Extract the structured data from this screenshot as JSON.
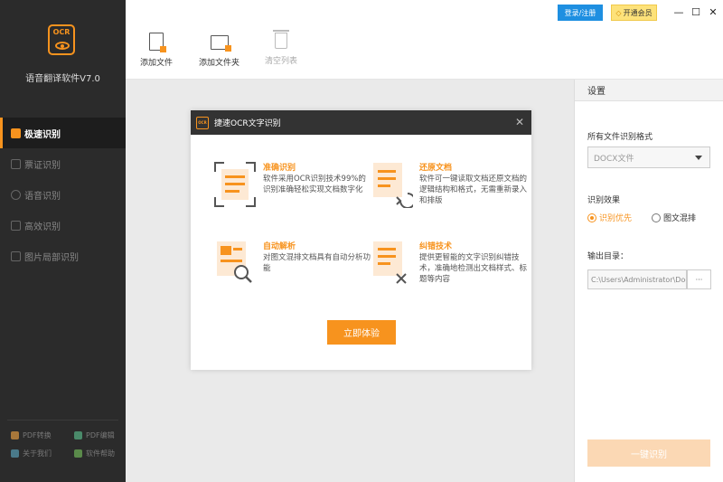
{
  "app": {
    "title": "语音翻译软件V7.0",
    "logo_text": "OCR"
  },
  "sidebar": {
    "items": [
      {
        "label": "极速识别",
        "icon": "lightning-doc-icon",
        "active": true
      },
      {
        "label": "票证识别",
        "icon": "ticket-icon",
        "active": false
      },
      {
        "label": "语音识别",
        "icon": "microphone-icon",
        "active": false
      },
      {
        "label": "高效识别",
        "icon": "scan-icon",
        "active": false
      },
      {
        "label": "图片局部识别",
        "icon": "image-crop-icon",
        "active": false
      }
    ],
    "footer": [
      {
        "label": "PDF转换",
        "icon": "pdf-convert-icon"
      },
      {
        "label": "PDF编辑",
        "icon": "pdf-edit-icon"
      },
      {
        "label": "关于我们",
        "icon": "about-icon"
      },
      {
        "label": "软件帮助",
        "icon": "help-icon"
      }
    ]
  },
  "topbar": {
    "login_label": "登录/注册",
    "vip_label": "开通会员",
    "minimize": "—",
    "maximize": "☐",
    "close": "✕"
  },
  "toolbar": {
    "add_file": "添加文件",
    "add_folder": "添加文件夹",
    "clear_list": "清空列表"
  },
  "settings": {
    "header": "设置",
    "format_label": "所有文件识别格式",
    "format_value": "DOCX文件",
    "effect_label": "识别效果",
    "effect_options": [
      {
        "label": "识别优先",
        "selected": true
      },
      {
        "label": "图文混排",
        "selected": false
      }
    ],
    "output_label": "输出目录：",
    "output_path": "C:\\Users\\Administrator\\Docu",
    "browse_label": "···",
    "ocr_button": "一键识别"
  },
  "modal": {
    "title": "捷速OCR文字识别",
    "close": "✕",
    "features": [
      {
        "title": "准确识别",
        "desc": "软件采用OCR识别技术99%的识别准确轻松实现文档数字化",
        "icon": "accurate-scan-icon"
      },
      {
        "title": "还原文档",
        "desc": "软件可一键读取文档还原文档的逻辑结构和格式，无需重新录入和排版",
        "icon": "restore-doc-icon"
      },
      {
        "title": "自动解析",
        "desc": "对图文混排文档具有自动分析功能",
        "icon": "auto-parse-icon"
      },
      {
        "title": "纠错技术",
        "desc": "提供更智能的文字识别纠错技术，准确地检测出文档样式、标题等内容",
        "icon": "error-correct-icon"
      }
    ],
    "try_button": "立即体验"
  },
  "colors": {
    "accent": "#f7931e",
    "sidebar_bg": "#2b2b2b",
    "login_blue": "#1e8fe1",
    "vip_yellow": "#fde27a"
  }
}
